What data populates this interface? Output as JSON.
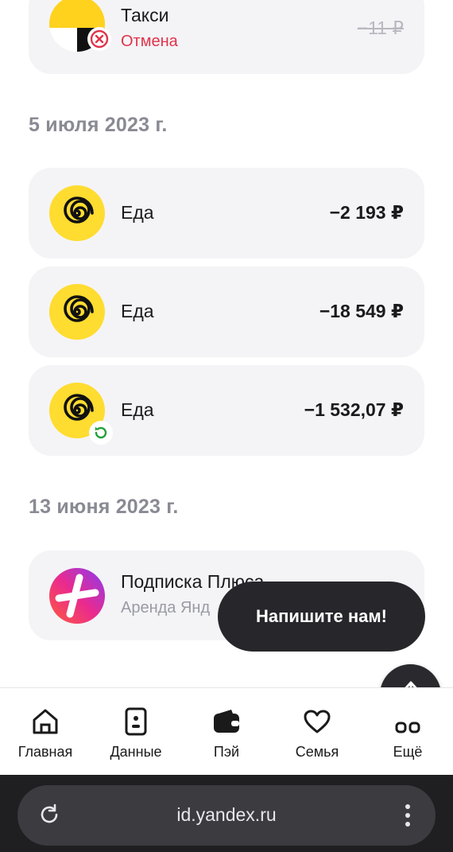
{
  "transactions_top": [
    {
      "title": "Такси",
      "status": "Отмена",
      "amount": "−11 ₽"
    }
  ],
  "groups": [
    {
      "date": "5 июля 2023 г.",
      "items": [
        {
          "title": "Еда",
          "amount": "−2 193 ₽"
        },
        {
          "title": "Еда",
          "amount": "−18 549 ₽"
        },
        {
          "title": "Еда",
          "amount": "−1 532,07 ₽"
        }
      ]
    },
    {
      "date": "13 июня 2023 г.",
      "items": [
        {
          "title": "Подписка Плюса",
          "subtitle": "Аренда Янд"
        }
      ]
    }
  ],
  "chat_button": {
    "label": "Напишите нам!"
  },
  "scroll_top": {
    "icon": "arrow-up-icon"
  },
  "nav": [
    {
      "label": "Главная",
      "icon": "home-icon"
    },
    {
      "label": "Данные",
      "icon": "id-card-icon"
    },
    {
      "label": "Пэй",
      "icon": "wallet-icon"
    },
    {
      "label": "Семья",
      "icon": "heart-icon"
    },
    {
      "label": "Ещё",
      "icon": "more-icon"
    }
  ],
  "browser": {
    "url": "id.yandex.ru"
  },
  "colors": {
    "card_bg": "#f4f4f7",
    "cancel_red": "#e0334a",
    "eda_yellow": "#ffdc30",
    "refund_green": "#21a038",
    "date_gray": "#8a8a94"
  }
}
